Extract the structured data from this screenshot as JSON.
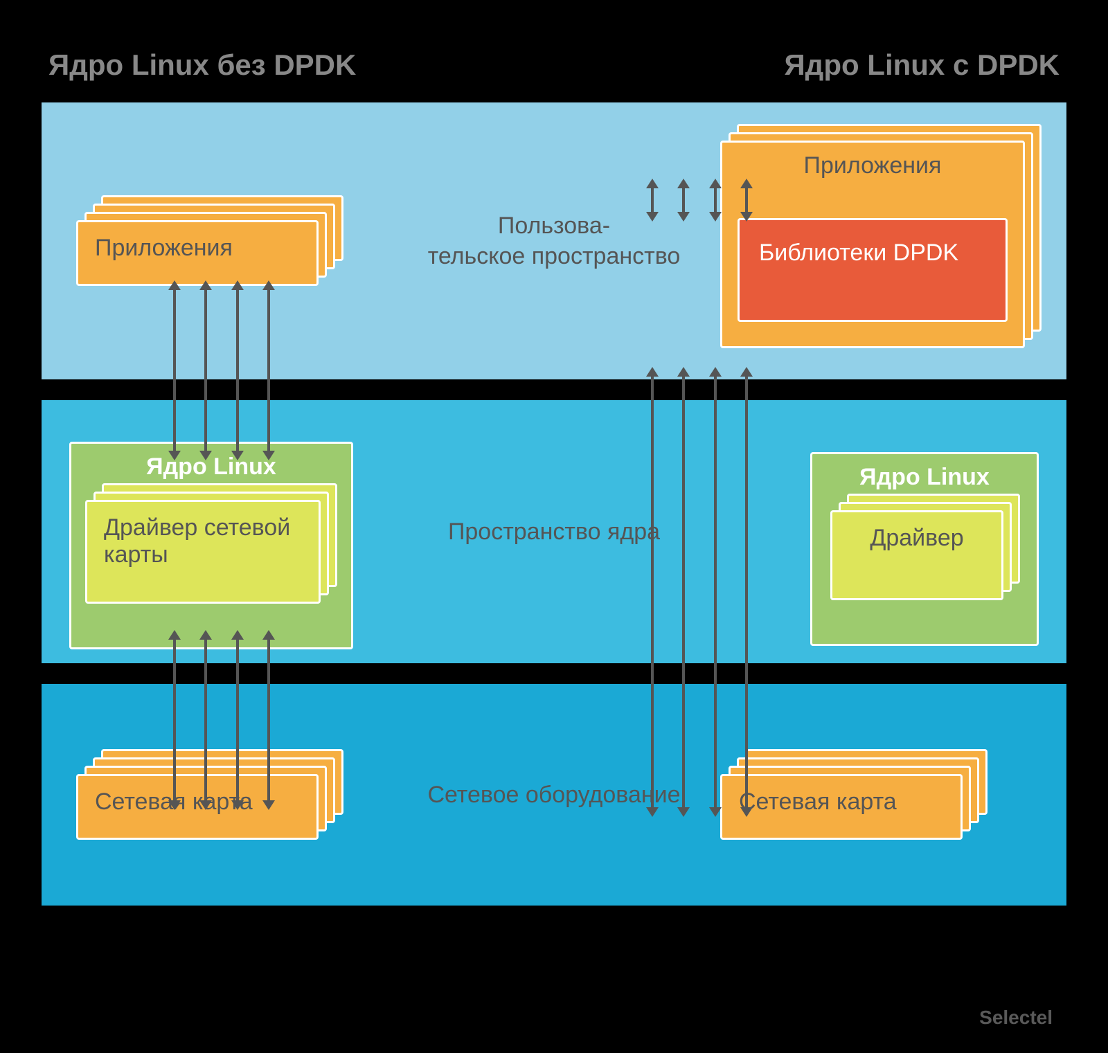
{
  "titles": {
    "left": "Ядро Linux без DPDK",
    "right": "Ядро Linux с DPDK"
  },
  "layers": {
    "user": "Пользова-\nтельское пространство",
    "kernel": "Пространство ядра",
    "hardware": "Сетевое оборудование"
  },
  "left": {
    "applications": "Приложения",
    "kernel_title": "Ядро Linux",
    "driver": "Драйвер сетевой карты",
    "nic": "Сетевая карта"
  },
  "right": {
    "applications": "Приложения",
    "dpdk": "Библиотеки DPDK",
    "kernel_title": "Ядро Linux",
    "driver": "Драйвер",
    "nic": "Сетевая карта"
  },
  "watermark": "Selectel",
  "colors": {
    "orange": "#F6AE41",
    "red": "#E85B3A",
    "yellow": "#DDE55A",
    "green": "#9DCB6E",
    "blue_light": "#92D0E8",
    "blue_mid": "#3DBCE0",
    "blue_dark": "#1BA9D5",
    "arrow": "#555555"
  }
}
